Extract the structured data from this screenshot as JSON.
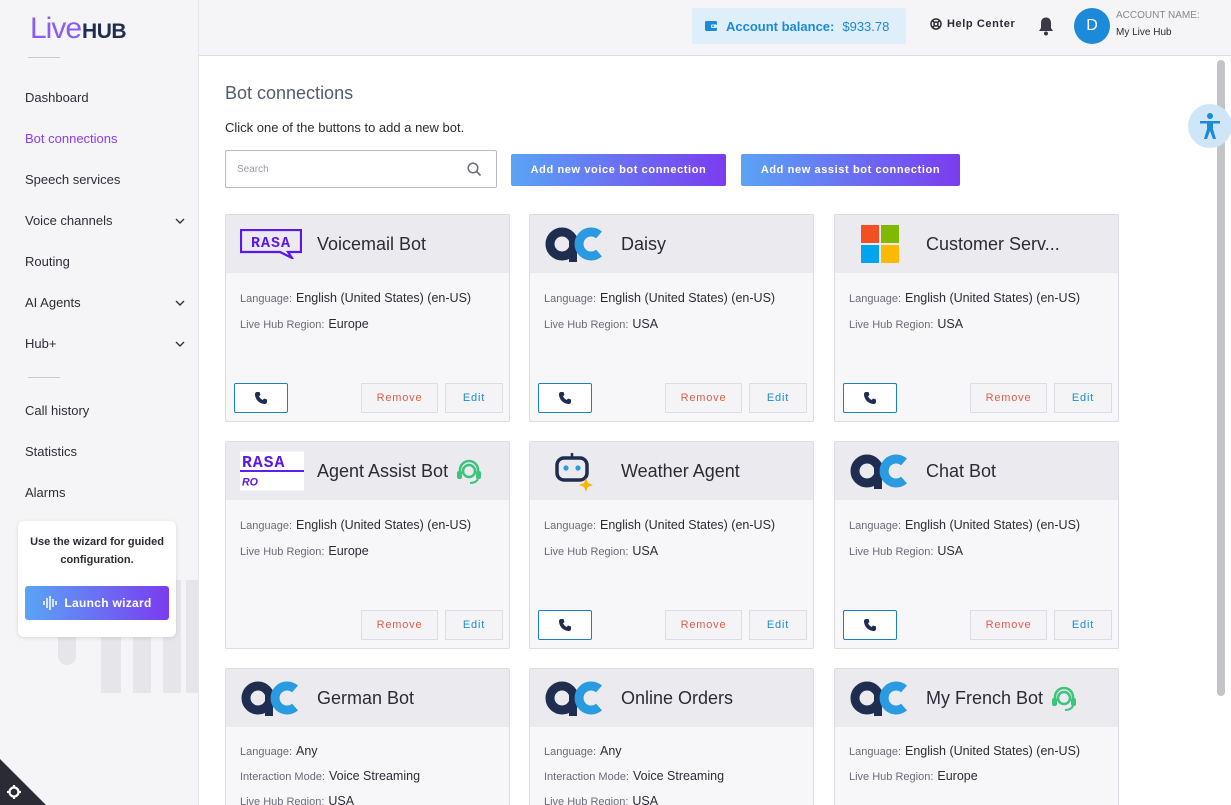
{
  "brand": {
    "logo_live": "Live",
    "logo_hub": "HUB"
  },
  "sidebar": {
    "items": [
      {
        "label": "Dashboard"
      },
      {
        "label": "Bot connections",
        "active": true
      },
      {
        "label": "Speech services"
      },
      {
        "label": "Voice channels",
        "expandable": true
      },
      {
        "label": "Routing"
      },
      {
        "label": "AI Agents",
        "expandable": true
      },
      {
        "label": "Hub+",
        "expandable": true
      },
      {
        "label": "Call history"
      },
      {
        "label": "Statistics"
      },
      {
        "label": "Alarms"
      }
    ],
    "wizard": {
      "text": "Use the wizard for guided configuration.",
      "button": "Launch wizard"
    }
  },
  "header": {
    "balance_label": "Account balance:",
    "balance_value": "$933.78",
    "help": "Help Center",
    "avatar_initial": "D",
    "account_label": "ACCOUNT NAME:",
    "account_name": "My Live Hub"
  },
  "main": {
    "title": "Bot connections",
    "subtitle": "Click one of the buttons to add a new bot.",
    "search_placeholder": "Search",
    "add_voice": "Add new voice bot connection",
    "add_assist": "Add new assist bot connection",
    "labels": {
      "language": "Language:",
      "region": "Live Hub Region:",
      "mode": "Interaction Mode:",
      "remove": "Remove",
      "edit": "Edit"
    },
    "cards": [
      {
        "title": "Voicemail Bot",
        "logo": "rasa",
        "language": "English (United States) (en-US)",
        "region": "Europe",
        "phone": true
      },
      {
        "title": "Daisy",
        "logo": "ac",
        "language": "English (United States) (en-US)",
        "region": "USA",
        "phone": true
      },
      {
        "title": "Customer Serv...",
        "logo": "microsoft",
        "language": "English (United States) (en-US)",
        "region": "USA",
        "phone": true
      },
      {
        "title": "Agent Assist Bot",
        "logo": "rasa-ro",
        "logo_text": "RO",
        "language": "English (United States) (en-US)",
        "region": "Europe",
        "phone": false,
        "assist_icon": true
      },
      {
        "title": "Weather Agent",
        "logo": "bot",
        "language": "English (United States) (en-US)",
        "region": "USA",
        "phone": true
      },
      {
        "title": "Chat Bot",
        "logo": "ac",
        "language": "English (United States) (en-US)",
        "region": "USA",
        "phone": true
      },
      {
        "title": "German Bot",
        "logo": "ac",
        "language": "Any",
        "mode": "Voice Streaming",
        "region": "USA"
      },
      {
        "title": "Online Orders",
        "logo": "ac",
        "language": "Any",
        "mode": "Voice Streaming",
        "region": "USA"
      },
      {
        "title": "My French Bot",
        "logo": "ac",
        "language": "English (United States) (en-US)",
        "region": "Europe",
        "assist_icon": true
      }
    ]
  },
  "colors": {
    "accent": "#8b3cf0",
    "blue": "#1b8ad9",
    "remove": "#e05d4f"
  }
}
